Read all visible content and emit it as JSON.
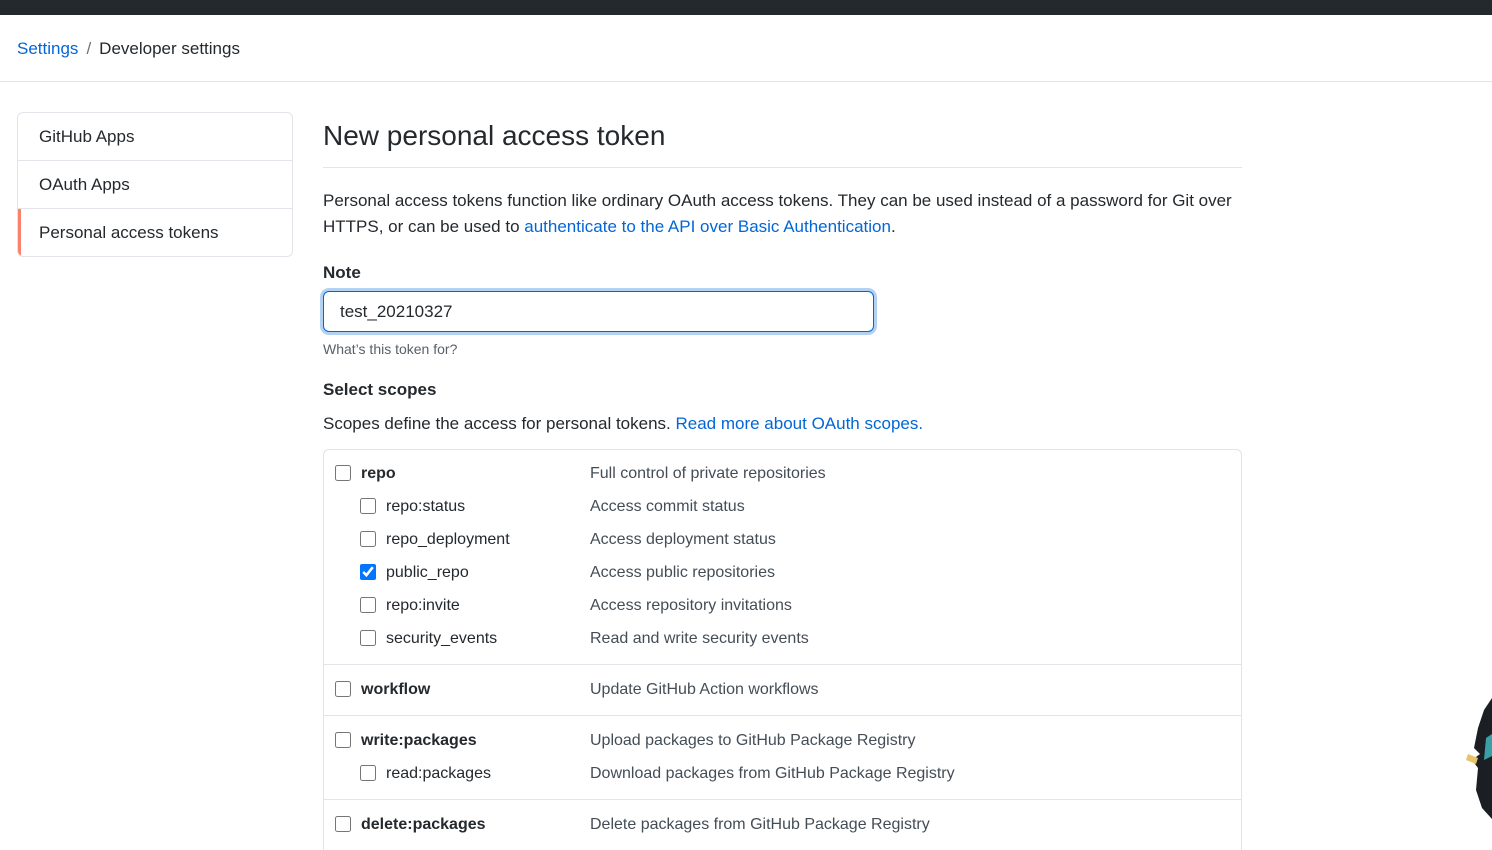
{
  "breadcrumb": {
    "settings": "Settings",
    "separator": "/",
    "current": "Developer settings"
  },
  "sidebar": {
    "items": [
      {
        "label": "GitHub Apps",
        "selected": false
      },
      {
        "label": "OAuth Apps",
        "selected": false
      },
      {
        "label": "Personal access tokens",
        "selected": true
      }
    ]
  },
  "main": {
    "title": "New personal access token",
    "intro_text": "Personal access tokens function like ordinary OAuth access tokens. They can be used instead of a password for Git over HTTPS, or can be used to ",
    "intro_link": "authenticate to the API over Basic Authentication",
    "intro_end": ".",
    "note": {
      "label": "Note",
      "value": "test_20210327",
      "help": "What’s this token for?"
    },
    "scopes": {
      "label": "Select scopes",
      "help_text": "Scopes define the access for personal tokens. ",
      "help_link": "Read more about OAuth scopes.",
      "groups": [
        {
          "name": "repo",
          "description": "Full control of private repositories",
          "checked": false,
          "children": [
            {
              "name": "repo:status",
              "description": "Access commit status",
              "checked": false
            },
            {
              "name": "repo_deployment",
              "description": "Access deployment status",
              "checked": false
            },
            {
              "name": "public_repo",
              "description": "Access public repositories",
              "checked": true
            },
            {
              "name": "repo:invite",
              "description": "Access repository invitations",
              "checked": false
            },
            {
              "name": "security_events",
              "description": "Read and write security events",
              "checked": false
            }
          ]
        },
        {
          "name": "workflow",
          "description": "Update GitHub Action workflows",
          "checked": false,
          "children": []
        },
        {
          "name": "write:packages",
          "description": "Upload packages to GitHub Package Registry",
          "checked": false,
          "children": [
            {
              "name": "read:packages",
              "description": "Download packages from GitHub Package Registry",
              "checked": false
            }
          ]
        },
        {
          "name": "delete:packages",
          "description": "Delete packages from GitHub Package Registry",
          "checked": false,
          "children": []
        }
      ]
    }
  },
  "colors": {
    "topbar": "#24292e",
    "link": "#0366d6",
    "selected_accent": "#f9826c",
    "border": "#e1e4e8"
  }
}
